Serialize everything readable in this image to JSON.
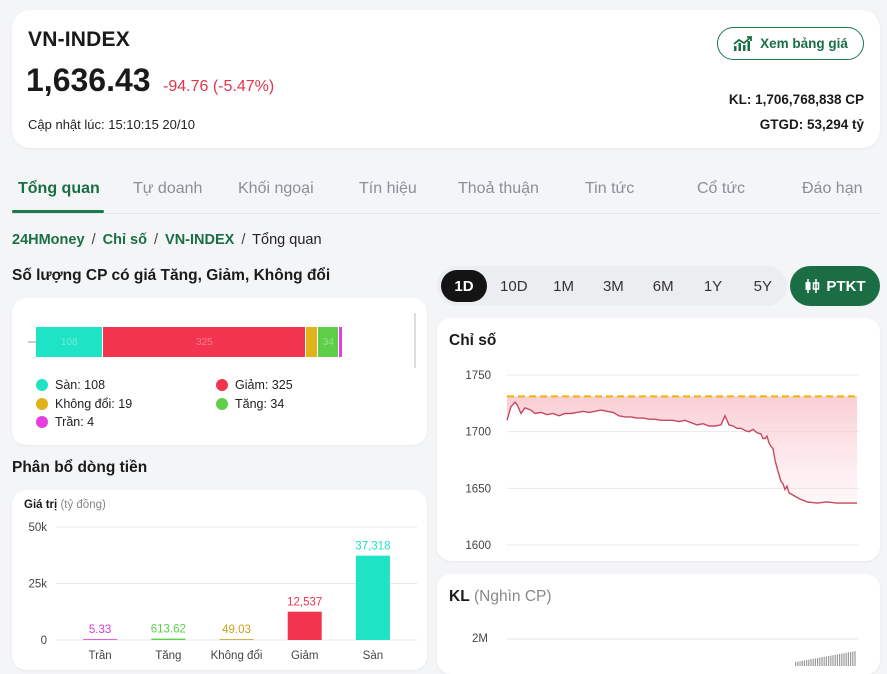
{
  "header": {
    "title": "VN-INDEX",
    "price": "1,636.43",
    "change": "-94.76 (-5.47%)",
    "updated": "Cập nhật lúc: 15:10:15 20/10",
    "view_board_label": "Xem bảng giá",
    "kl": "KL: 1,706,768,838 CP",
    "gtgd": "GTGD: 53,294 tỷ"
  },
  "tabs": [
    "Tổng quan",
    "Tự doanh",
    "Khối ngoại",
    "Tín hiệu",
    "Thoả thuận",
    "Tin tức",
    "Cổ tức",
    "Đáo hạn"
  ],
  "breadcrumb": {
    "home": "24HMoney",
    "sep": "/",
    "section": "Chỉ số",
    "index": "VN-INDEX",
    "current": "Tổng quan"
  },
  "breadth": {
    "title": "Số lượng CP có giá Tăng, Giảm, Không đổi",
    "segments": [
      {
        "label": "Sàn",
        "value": 108,
        "color": "#1ee3c5",
        "bar_text": "108"
      },
      {
        "label": "Giảm",
        "value": 325,
        "color": "#f2344f",
        "bar_text": "325"
      },
      {
        "label": "Không đổi",
        "value": 19,
        "color": "#e0b31a",
        "bar_text": ""
      },
      {
        "label": "Tăng",
        "value": 34,
        "color": "#5fcf4a",
        "bar_text": "34"
      },
      {
        "label": "Trần",
        "value": 4,
        "color": "#e83ee0",
        "bar_text": ""
      }
    ],
    "legend": [
      {
        "text": "Sàn: 108",
        "color": "#1ee3c5"
      },
      {
        "text": "Giảm: 325",
        "color": "#f2344f"
      },
      {
        "text": "Không đổi: 19",
        "color": "#e0b31a"
      },
      {
        "text": "Tăng: 34",
        "color": "#5fcf4a"
      },
      {
        "text": "Trần: 4",
        "color": "#e83ee0"
      }
    ]
  },
  "money_flow": {
    "title": "Phân bổ dòng tiền",
    "axis_label": "Giá trị",
    "axis_unit": "(tỷ đồng)"
  },
  "period": {
    "options": [
      "1D",
      "10D",
      "1M",
      "3M",
      "6M",
      "1Y",
      "5Y"
    ],
    "selected": "1D",
    "ptkt_label": "PTKT"
  },
  "index_chart": {
    "title": "Chỉ số"
  },
  "volume_chart": {
    "title": "KL",
    "unit": "(Nghìn CP)",
    "tick": "2M"
  },
  "chart_data": [
    {
      "type": "bar",
      "categories": [
        "Trần",
        "Tăng",
        "Không đổi",
        "Giảm",
        "Sàn"
      ],
      "values": [
        5.33,
        613.62,
        49.03,
        12537,
        37318
      ],
      "value_labels": [
        "5.33",
        "613.62",
        "49.03",
        "12,537",
        "37,318"
      ],
      "colors": [
        "#d63ad0",
        "#5fcf4a",
        "#c9a21a",
        "#f2344f",
        "#1ee3c5"
      ],
      "yticks": [
        "0",
        "25k",
        "50k"
      ],
      "ylim": [
        0,
        50000
      ]
    },
    {
      "type": "area",
      "yticks": [
        1750,
        1700,
        1650,
        1600
      ],
      "ylim": [
        1600,
        1750
      ],
      "reference": 1731.19,
      "x": [
        0,
        4,
        8,
        10,
        14,
        18,
        24,
        28,
        34,
        40,
        46,
        52,
        58,
        64,
        70,
        76,
        82,
        88,
        94,
        100,
        106,
        112,
        118,
        124,
        130,
        136,
        142,
        148,
        154,
        160,
        166,
        172,
        178,
        184,
        190,
        196,
        202,
        208,
        214,
        218,
        222,
        226,
        230,
        234,
        238,
        242,
        246,
        250,
        254,
        256,
        258,
        260,
        262,
        264,
        266,
        268,
        270,
        272,
        274,
        276,
        278,
        280,
        282,
        286,
        292,
        300,
        310,
        320,
        330,
        340,
        350
      ],
      "values": [
        1710,
        1722,
        1726,
        1724,
        1716,
        1721,
        1719,
        1716,
        1717,
        1715,
        1716,
        1714,
        1716,
        1716,
        1717,
        1718,
        1717,
        1718,
        1719,
        1718,
        1717,
        1714,
        1713,
        1713,
        1712,
        1712,
        1711,
        1711,
        1710,
        1710,
        1710,
        1709,
        1710,
        1708,
        1706,
        1707,
        1705,
        1705,
        1706,
        1714,
        1706,
        1705,
        1703,
        1703,
        1701,
        1700,
        1702,
        1699,
        1698,
        1694,
        1694,
        1696,
        1690,
        1687,
        1685,
        1675,
        1668,
        1662,
        1656,
        1654,
        1649,
        1652,
        1646,
        1644,
        1641,
        1638,
        1637,
        1638,
        1637,
        1637,
        1637
      ]
    }
  ]
}
